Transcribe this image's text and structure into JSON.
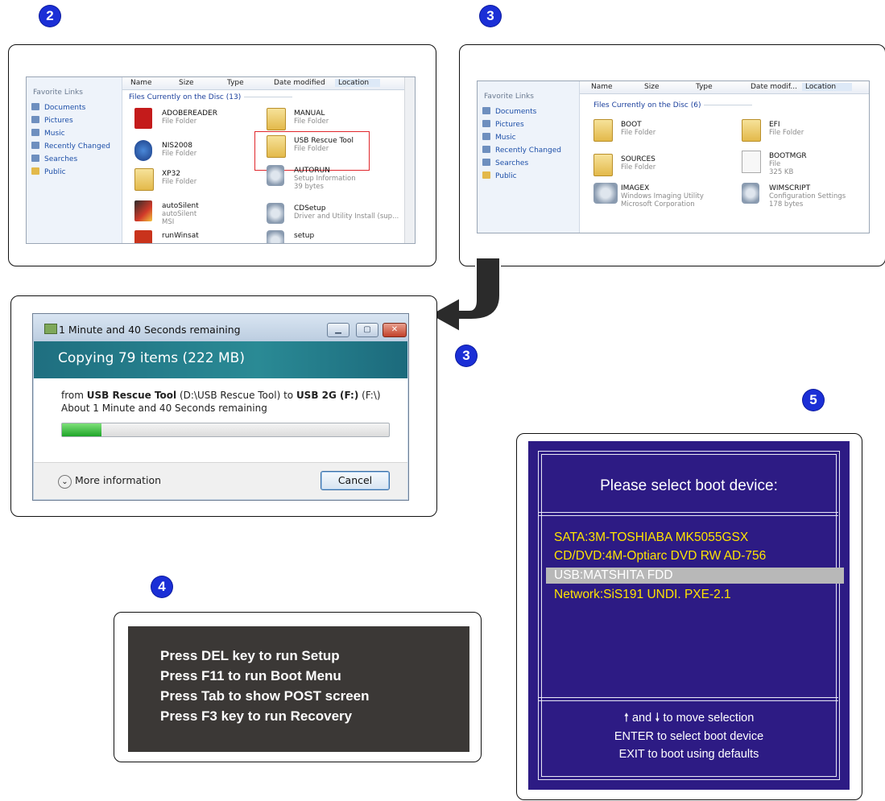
{
  "steps": {
    "s2": "2",
    "s3a": "3",
    "s3b": "3",
    "s4": "4",
    "s5": "5"
  },
  "explorer1": {
    "sidebar_title": "Favorite Links",
    "links": [
      "Documents",
      "Pictures",
      "Music",
      "Recently Changed",
      "Searches",
      "Public"
    ],
    "columns": [
      "Name",
      "Size",
      "Type",
      "Date modified",
      "Location"
    ],
    "group": "Files Currently on the Disc (13)",
    "items": [
      {
        "name": "ADOBEREADER",
        "sub": "File Folder",
        "icon": "pdf-folder-icon"
      },
      {
        "name": "MANUAL",
        "sub": "File Folder",
        "icon": "folder-icon"
      },
      {
        "name": "NIS2008",
        "sub": "File Folder",
        "icon": "norton-folder-icon"
      },
      {
        "name": "USB Rescue Tool",
        "sub": "File Folder",
        "icon": "folder-icon"
      },
      {
        "name": "XP32",
        "sub": "File Folder",
        "icon": "folder-icon"
      },
      {
        "name": "AUTORUN",
        "sub": "Setup Information",
        "sub2": "39 bytes",
        "icon": "setup-info-icon"
      },
      {
        "name": "autoSilent",
        "sub": "autoSilent",
        "sub2": "MSI",
        "icon": "msi-icon"
      },
      {
        "name": "CDSetup",
        "sub": "Driver and Utility Install (sup...",
        "icon": "installer-icon"
      },
      {
        "name": "runWinsat",
        "sub": "",
        "icon": "m-app-icon"
      },
      {
        "name": "setup",
        "sub": "",
        "icon": "setup-icon"
      }
    ]
  },
  "explorer2": {
    "sidebar_title": "Favorite Links",
    "links": [
      "Documents",
      "Pictures",
      "Music",
      "Recently Changed",
      "Searches",
      "Public"
    ],
    "columns": [
      "Name",
      "Size",
      "Type",
      "Date modif...",
      "Location"
    ],
    "group": "Files Currently on the Disc (6)",
    "items": [
      {
        "name": "BOOT",
        "sub": "File Folder"
      },
      {
        "name": "EFI",
        "sub": "File Folder"
      },
      {
        "name": "SOURCES",
        "sub": "File Folder"
      },
      {
        "name": "BOOTMGR",
        "sub": "File",
        "sub2": "325 KB"
      },
      {
        "name": "IMAGEX",
        "sub": "Windows Imaging Utility",
        "sub2": "Microsoft Corporation"
      },
      {
        "name": "WIMSCRIPT",
        "sub": "Configuration Settings",
        "sub2": "178 bytes"
      }
    ]
  },
  "copy_dialog": {
    "title": "1 Minute and 40 Seconds remaining",
    "heading": "Copying 79 items (222 MB)",
    "from_prefix": "from ",
    "source_name": "USB Rescue Tool",
    "source_path": " (D:\\USB Rescue Tool) to ",
    "dest_name": "USB 2G (F:)",
    "dest_path": " (F:\\)",
    "remaining": "About 1 Minute and 40 Seconds remaining",
    "progress": 0.12,
    "more_info": "More information",
    "cancel": "Cancel",
    "btn_min": "▁",
    "btn_max": "▢",
    "btn_close": "✕"
  },
  "post_screen": {
    "lines": [
      "Press DEL key to run Setup",
      "Press F11 to run Boot Menu",
      "Press Tab to show POST screen",
      "Press F3 key to run Recovery"
    ]
  },
  "boot_menu": {
    "title": "Please select boot device:",
    "options": [
      "SATA:3M-TOSHIABA MK5055GSX",
      "CD/DVD:4M-Optiarc DVD RW AD-756",
      "USB:MATSHITA FDD",
      "Network:SiS191 UNDI. PXE-2.1"
    ],
    "selected_index": 2,
    "footer1": "and",
    "footer1b": "to move selection",
    "footer2": "ENTER to select boot device",
    "footer3": "EXIT to boot using defaults",
    "up_arrow": "🠕",
    "down_arrow": "🠗"
  }
}
